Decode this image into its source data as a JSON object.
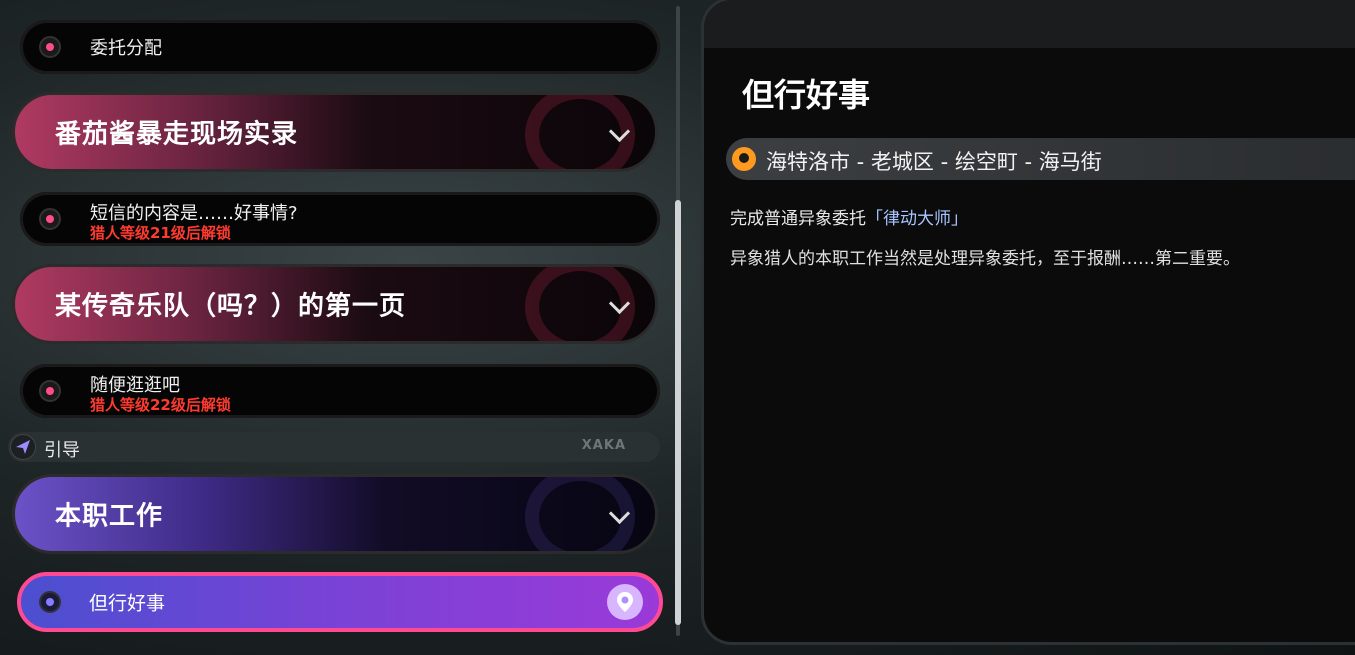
{
  "quest_list": {
    "items": [
      {
        "title": "委托分配"
      },
      {
        "chapter_title": "番茄酱暴走现场实录"
      },
      {
        "title": "短信的内容是……好事情?",
        "lock_text": "猎人等级21级后解锁"
      },
      {
        "chapter_title": "某传奇乐队（吗？）的第一页"
      },
      {
        "title": "随便逛逛吧",
        "lock_text": "猎人等级22级后解锁"
      }
    ],
    "guide": {
      "label": "引导",
      "logo_text": "XAKA"
    },
    "guide_chapter": {
      "chapter_title": "本职工作"
    },
    "active_item": {
      "title": "但行好事"
    }
  },
  "detail": {
    "title": "但行好事",
    "location": "海特洛市 - 老城区 - 绘空町 - 海马街",
    "objective_prefix": "完成普通异象委托",
    "objective_highlight": "「律动大师」",
    "description": "异象猎人的本职工作当然是处理异象委托，至于报酬……第二重要。"
  },
  "colors": {
    "accent_pink": "#ff4a93",
    "lock_red": "#ff3a2e",
    "location_icon": "#ff9a1f",
    "highlight_blue": "#a8c6ff"
  }
}
